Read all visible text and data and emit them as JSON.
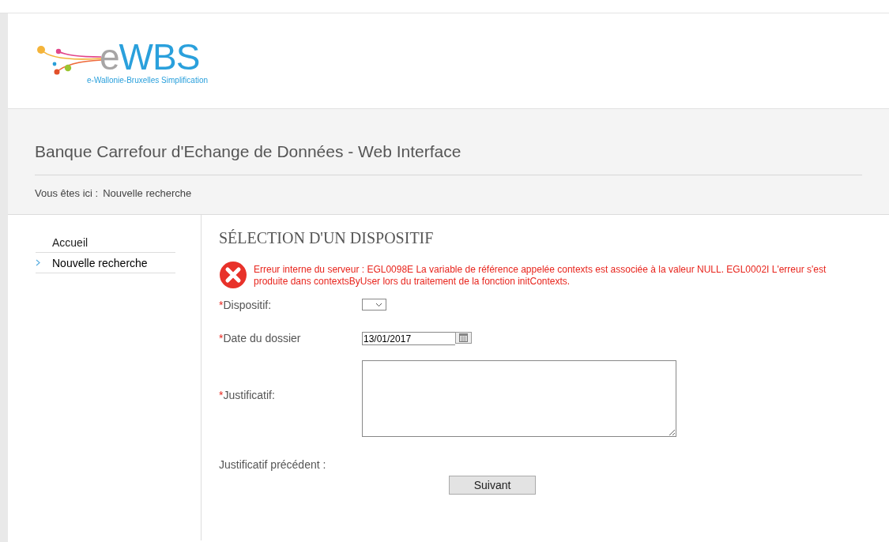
{
  "logo": {
    "wordmark_prefix": "e",
    "wordmark": "WBS",
    "tagline": "e-Wallonie-Bruxelles Simplification"
  },
  "header": {
    "title": "Banque Carrefour d'Echange de Données - Web Interface",
    "breadcrumb_label": "Vous êtes ici :",
    "breadcrumb_current": "Nouvelle recherche"
  },
  "sidebar": {
    "items": [
      {
        "label": "Accueil",
        "selected": false
      },
      {
        "label": "Nouvelle recherche",
        "selected": true
      }
    ]
  },
  "main": {
    "heading": "SÉLECTION D'UN DISPOSITIF",
    "error": "Erreur interne du serveur : EGL0098E La variable de référence appelée contexts est associée à la valeur NULL. EGL0002I L'erreur s'est produite dans contextsByUser lors du traitement de la fonction initContexts.",
    "required_mark": "*",
    "fields": [
      {
        "kind": "select",
        "label": "Dispositif:",
        "required": true
      },
      {
        "kind": "date",
        "label": "Date du dossier",
        "required": true,
        "value": "13/01/2017"
      },
      {
        "kind": "textarea",
        "label": "Justificatif:",
        "required": true
      },
      {
        "kind": "text",
        "label": "Justificatif précédent :",
        "required": false
      }
    ],
    "button": "Suivant"
  }
}
